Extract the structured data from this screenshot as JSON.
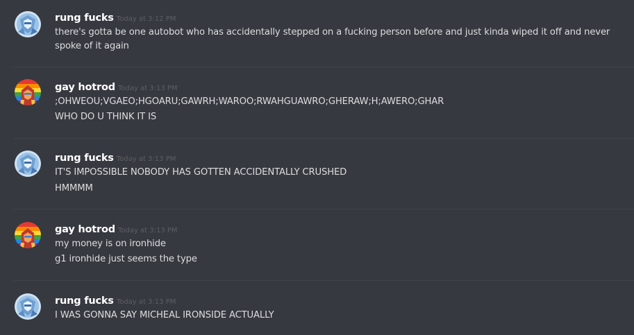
{
  "messages": [
    {
      "username": "rung fucks",
      "timestamp": "Today at 3:12 PM",
      "avatar_icon": "rung-avatar-icon",
      "lines": [
        "there's gotta be one autobot who has accidentally stepped on a fucking person before and just kinda wiped it off and never spoke of it again"
      ]
    },
    {
      "username": "gay hotrod",
      "timestamp": "Today at 3:13 PM",
      "avatar_icon": "hotrod-avatar-icon",
      "lines": [
        ";OHWEOU;VGAEO;HGOARU;GAWRH;WAROO;RWAHGUAWRO;GHERAW;H;AWERO;GHAR",
        "WHO DO U THINK IT IS"
      ]
    },
    {
      "username": "rung fucks",
      "timestamp": "Today at 3:13 PM",
      "avatar_icon": "rung-avatar-icon",
      "lines": [
        "IT'S IMPOSSIBLE NOBODY HAS GOTTEN ACCIDENTALLY CRUSHED",
        "HMMMM"
      ]
    },
    {
      "username": "gay hotrod",
      "timestamp": "Today at 3:13 PM",
      "avatar_icon": "hotrod-avatar-icon",
      "lines": [
        "my money is on ironhide",
        "g1 ironhide just seems the type"
      ]
    },
    {
      "username": "rung fucks",
      "timestamp": "Today at 3:13 PM",
      "avatar_icon": "rung-avatar-icon",
      "lines": [
        "I WAS GONNA SAY MICHEAL IRONSIDE ACTUALLY"
      ]
    }
  ],
  "colors": {
    "background": "#36393f",
    "username": "#ffffff",
    "timestamp": "#5c5f65",
    "message_text": "#dcddde",
    "divider": "#40434a"
  }
}
